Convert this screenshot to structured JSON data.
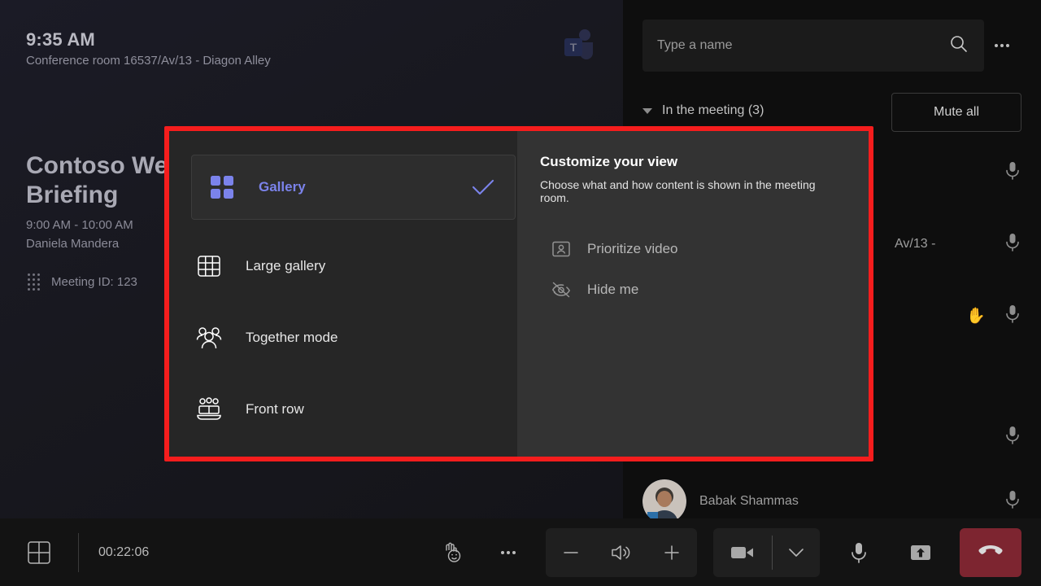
{
  "stage": {
    "clock": "9:35 AM",
    "room": "Conference room 16537/Av/13 - Diagon Alley",
    "logo_icon": "microsoft-teams-logo",
    "meeting": {
      "title": "Contoso Weekly Briefing",
      "time": "9:00 AM - 10:00 AM",
      "organizer": "Daniela Mandera",
      "meeting_id": "Meeting ID: 123",
      "dialpad_icon": "dialpad-icon"
    }
  },
  "roster": {
    "search": {
      "placeholder": "Type a name",
      "value": "",
      "icon": "search-icon"
    },
    "more_icon": "more-options-icon",
    "section_label": "In the meeting (3)",
    "mute_all_label": "Mute all",
    "caret_icon": "chevron-down-icon",
    "participants": [
      {
        "name": "",
        "mic_icon": "microphone-icon",
        "hand_raised": false,
        "avatar": "initials"
      },
      {
        "name": "Av/13 -",
        "mic_icon": "microphone-icon",
        "hand_raised": false,
        "avatar": "initials"
      },
      {
        "name": "",
        "mic_icon": "microphone-icon",
        "hand_raised": true,
        "hand_icon": "raised-hand-icon",
        "avatar": "initials"
      },
      {
        "name": "",
        "mic_icon": "microphone-icon",
        "hand_raised": false,
        "avatar": "initials"
      },
      {
        "name": "Babak Shammas",
        "mic_icon": "microphone-icon",
        "hand_raised": false,
        "avatar": "photo"
      }
    ]
  },
  "dialog": {
    "views": [
      {
        "label": "Gallery",
        "icon": "gallery-icon",
        "selected": true,
        "check_icon": "checkmark-icon"
      },
      {
        "label": "Large gallery",
        "icon": "large-gallery-icon",
        "selected": false
      },
      {
        "label": "Together mode",
        "icon": "together-mode-icon",
        "selected": false
      },
      {
        "label": "Front row",
        "icon": "front-row-icon",
        "selected": false
      }
    ],
    "panel_title": "Customize your view",
    "panel_subtitle": "Choose what and how content is shown in the meeting room.",
    "options": [
      {
        "label": "Prioritize video",
        "icon": "prioritize-video-icon"
      },
      {
        "label": "Hide me",
        "icon": "eye-off-icon"
      }
    ]
  },
  "toolbar": {
    "layout_icon": "layout-grid-icon",
    "timer": "00:22:06",
    "reactions_icon": "raise-hand-reactions-icon",
    "more_icon": "more-options-icon",
    "volume_down_icon": "minus-icon",
    "speaker_icon": "speaker-icon",
    "volume_up_icon": "plus-icon",
    "camera_icon": "camera-icon",
    "camera_menu_icon": "chevron-down-icon",
    "mic_icon": "microphone-icon",
    "share_icon": "share-screen-icon",
    "hangup_icon": "hangup-icon"
  },
  "colors": {
    "accent": "#7b83eb",
    "hangup": "#7d2530",
    "annotation": "#f51d1d"
  }
}
